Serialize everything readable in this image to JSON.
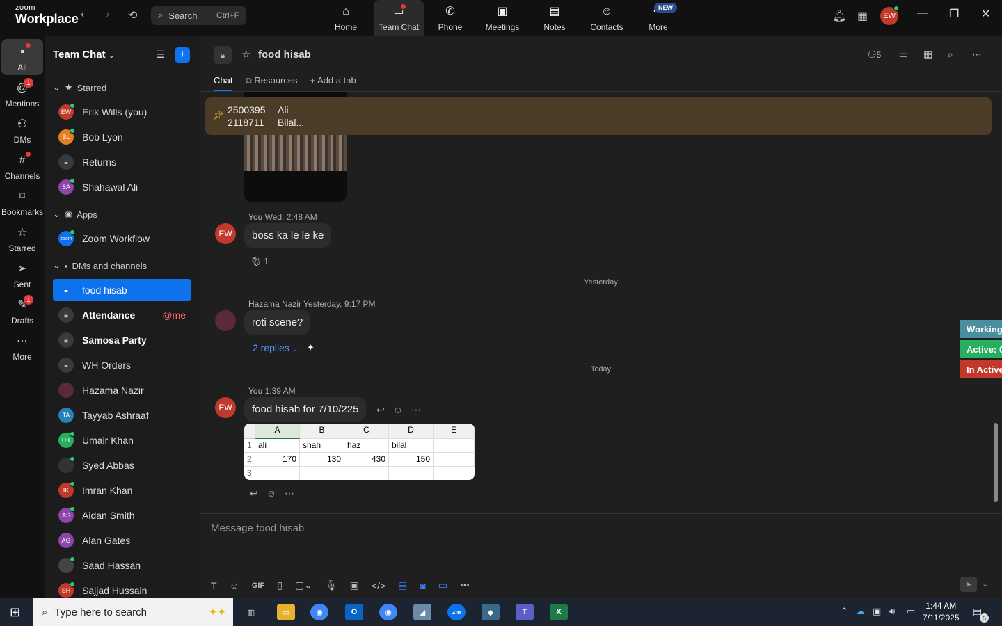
{
  "app": {
    "logo_top": "zoom",
    "logo_bottom": "Workplace"
  },
  "search": {
    "label": "Search",
    "shortcut": "Ctrl+F"
  },
  "nav": {
    "tabs": [
      {
        "label": "Home",
        "icon": "home-icon"
      },
      {
        "label": "Team Chat",
        "icon": "chat-icon"
      },
      {
        "label": "Phone",
        "icon": "phone-icon"
      },
      {
        "label": "Meetings",
        "icon": "video-icon"
      },
      {
        "label": "Notes",
        "icon": "notes-icon"
      },
      {
        "label": "Contacts",
        "icon": "contacts-icon"
      },
      {
        "label": "More",
        "icon": "more-icon"
      }
    ],
    "new_badge": "NEW",
    "user_initials": "EW"
  },
  "rail": {
    "items": [
      {
        "label": "All",
        "icon": "chat-bubble-icon"
      },
      {
        "label": "Mentions",
        "icon": "at-icon",
        "badge": "1"
      },
      {
        "label": "DMs",
        "icon": "people-icon"
      },
      {
        "label": "Channels",
        "icon": "hash-icon"
      },
      {
        "label": "Bookmarks",
        "icon": "bookmark-icon"
      },
      {
        "label": "Starred",
        "icon": "star-icon"
      },
      {
        "label": "Sent",
        "icon": "send-icon"
      },
      {
        "label": "Drafts",
        "icon": "draft-icon",
        "badge": "1"
      },
      {
        "label": "More",
        "icon": "ellipsis-icon"
      }
    ]
  },
  "sidebar": {
    "title": "Team Chat",
    "sections": {
      "starred": "Starred",
      "apps": "Apps",
      "dms": "DMs and channels"
    },
    "starred": [
      {
        "name": "Erik Wills (you)",
        "initials": "EW",
        "color": "#c0392b"
      },
      {
        "name": "Bob Lyon",
        "initials": "BL",
        "color": "#e67e22"
      },
      {
        "name": "Returns",
        "initials": "",
        "color": ""
      },
      {
        "name": "Shahawal Ali",
        "initials": "SA",
        "color": "#8e44ad"
      }
    ],
    "apps": [
      {
        "name": "Zoom Workflow",
        "initials": "zoom",
        "color": "#0e72ed"
      }
    ],
    "dms": [
      {
        "name": "food hisab",
        "mention": ""
      },
      {
        "name": "Attendance",
        "mention": "@me"
      },
      {
        "name": "Samosa Party",
        "mention": ""
      },
      {
        "name": "WH Orders",
        "mention": ""
      },
      {
        "name": "Hazama Nazir",
        "initials": "",
        "color": "#5a2a3a"
      },
      {
        "name": "Tayyab Ashraaf",
        "initials": "TA",
        "color": "#2980b9"
      },
      {
        "name": "Umair Khan",
        "initials": "UK",
        "color": "#27ae60"
      },
      {
        "name": "Syed Abbas",
        "initials": "",
        "color": "#333333"
      },
      {
        "name": "Imran Khan",
        "initials": "IK",
        "color": "#c0392b"
      },
      {
        "name": "Aidan Smith",
        "initials": "AS",
        "color": "#8e44ad"
      },
      {
        "name": "Alan Gates",
        "initials": "AG",
        "color": "#8e44ad"
      },
      {
        "name": "Saad Hassan",
        "initials": "",
        "color": "#444444"
      },
      {
        "name": "Sajjad Hussain",
        "initials": "SH",
        "color": "#c0392b"
      }
    ]
  },
  "channel": {
    "title": "food hisab",
    "members": "5",
    "tabs": {
      "chat": "Chat",
      "resources": "Resources",
      "add": "Add a tab"
    }
  },
  "pinned": {
    "line1_id": "2500395",
    "line1_name": "Ali",
    "line2_id": "2118711",
    "line2_name": "Bilal..."
  },
  "messages": {
    "m1": {
      "sender": "You",
      "time": "Wed, 2:48 AM",
      "text": "boss ka le le ke",
      "reaction": "1",
      "avatar": "EW"
    },
    "sep1": "Yesterday",
    "m2": {
      "sender": "Hazama Nazir",
      "time": "Yesterday, 9:17 PM",
      "text": "roti scene?",
      "replies": "2 replies"
    },
    "sep2": "Today",
    "m3": {
      "sender": "You",
      "time": "1:39 AM",
      "text": "food hisab for 7/10/225",
      "avatar": "EW"
    }
  },
  "sheet": {
    "cols": [
      "A",
      "B",
      "C",
      "D",
      "E"
    ],
    "rows": [
      "1",
      "2",
      "3"
    ],
    "row1": [
      "ali",
      "shah",
      "haz",
      "bilal",
      ""
    ],
    "row2": [
      "170",
      "130",
      "430",
      "150",
      ""
    ]
  },
  "status": {
    "working": "Working",
    "active": "Active: 0",
    "inactive": "In Active"
  },
  "composer": {
    "placeholder": "Message food hisab",
    "gif": "GIF"
  },
  "taskbar": {
    "search": "Type here to search",
    "time": "1:44 AM",
    "date": "7/11/2025",
    "notif": "5"
  },
  "colors": {
    "accent": "#0e72ed",
    "pinned_bg": "#4a3c26",
    "working": "#4a8fa0",
    "active": "#27ae60",
    "inactive": "#c0392b"
  }
}
